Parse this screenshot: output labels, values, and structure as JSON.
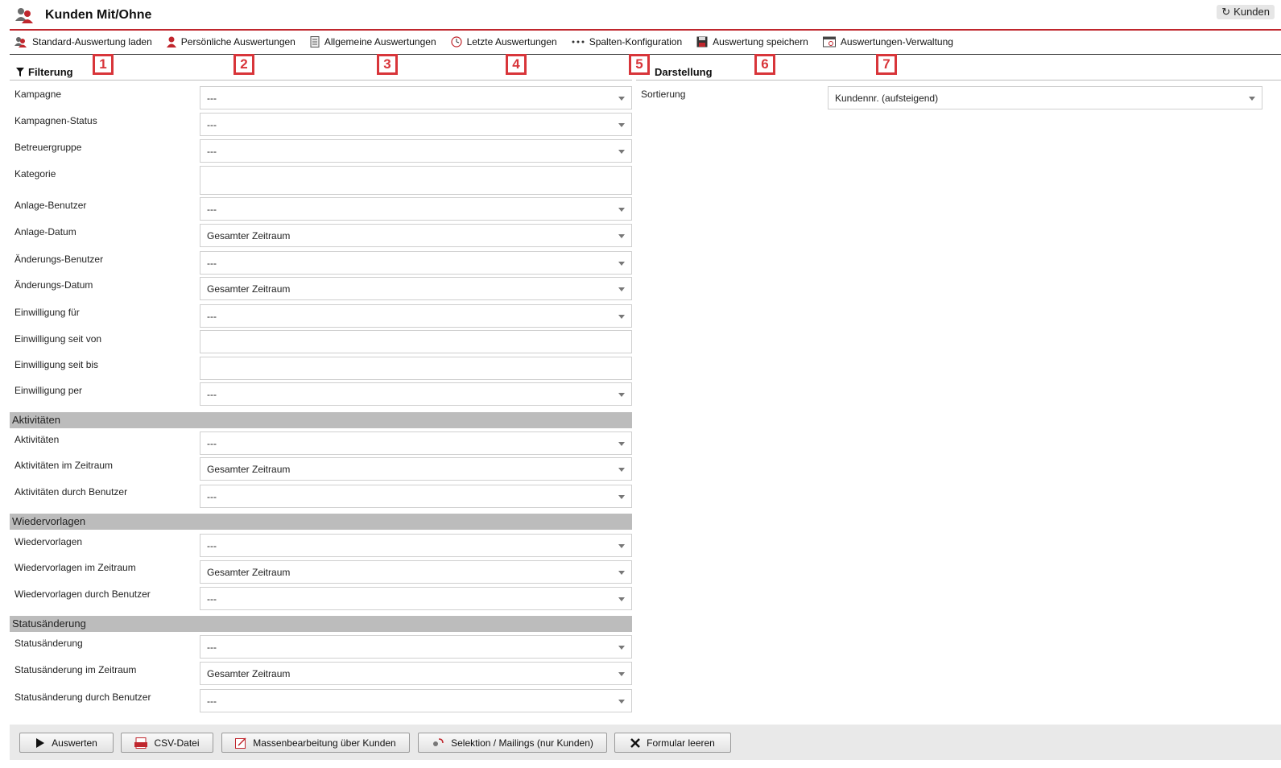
{
  "header": {
    "title": "Kunden Mit/Ohne",
    "back_button": "Kunden"
  },
  "toolbar": {
    "items": [
      {
        "label": "Standard-Auswertung laden",
        "icon": "users-icon"
      },
      {
        "label": "Persönliche Auswertungen",
        "icon": "user-icon"
      },
      {
        "label": "Allgemeine Auswertungen",
        "icon": "document-icon"
      },
      {
        "label": "Letzte Auswertungen",
        "icon": "clock-icon"
      },
      {
        "label": "Spalten-Konfiguration",
        "icon": "dots-icon"
      },
      {
        "label": "Auswertung speichern",
        "icon": "floppy-icon"
      },
      {
        "label": "Auswertungen-Verwaltung",
        "icon": "window-icon"
      }
    ]
  },
  "badges": [
    "1",
    "2",
    "3",
    "4",
    "5",
    "6",
    "7"
  ],
  "filter": {
    "title": "Filterung",
    "fields": [
      {
        "label": "Kampagne",
        "value": "---"
      },
      {
        "label": "Kampagnen-Status",
        "value": "---"
      },
      {
        "label": "Betreuergruppe",
        "value": "---"
      },
      {
        "label": "Kategorie",
        "value": ""
      },
      {
        "label": "Anlage-Benutzer",
        "value": "---"
      },
      {
        "label": "Anlage-Datum",
        "value": "Gesamter Zeitraum"
      },
      {
        "label": "Änderungs-Benutzer",
        "value": "---"
      },
      {
        "label": "Änderungs-Datum",
        "value": "Gesamter Zeitraum"
      },
      {
        "label": "Einwilligung für",
        "value": "---"
      },
      {
        "label": "Einwilligung seit von",
        "value": ""
      },
      {
        "label": "Einwilligung seit bis",
        "value": ""
      },
      {
        "label": "Einwilligung per",
        "value": "---"
      }
    ]
  },
  "groups": {
    "aktivitaeten": {
      "title": "Aktivitäten",
      "fields": [
        {
          "label": "Aktivitäten",
          "value": "---"
        },
        {
          "label": "Aktivitäten im Zeitraum",
          "value": "Gesamter Zeitraum"
        },
        {
          "label": "Aktivitäten durch Benutzer",
          "value": "---"
        }
      ]
    },
    "wiedervorlagen": {
      "title": "Wiedervorlagen",
      "fields": [
        {
          "label": "Wiedervorlagen",
          "value": "---"
        },
        {
          "label": "Wiedervorlagen im Zeitraum",
          "value": "Gesamter Zeitraum"
        },
        {
          "label": "Wiedervorlagen durch Benutzer",
          "value": "---"
        }
      ]
    },
    "statusaenderung": {
      "title": "Statusänderung",
      "fields": [
        {
          "label": "Statusänderung",
          "value": "---"
        },
        {
          "label": "Statusänderung im Zeitraum",
          "value": "Gesamter Zeitraum"
        },
        {
          "label": "Statusänderung durch Benutzer",
          "value": "---"
        }
      ]
    }
  },
  "darstellung": {
    "title": "Darstellung",
    "sort_label": "Sortierung",
    "sort_value": "Kundennr. (aufsteigend)"
  },
  "footer": {
    "buttons": [
      {
        "label": "Auswerten",
        "icon": "play-icon"
      },
      {
        "label": "CSV-Datei",
        "icon": "csv-icon"
      },
      {
        "label": "Massenbearbeitung über Kunden",
        "icon": "edit-icon"
      },
      {
        "label": "Selektion / Mailings (nur Kunden)",
        "icon": "mailing-icon"
      },
      {
        "label": "Formular leeren",
        "icon": "close-icon"
      }
    ]
  }
}
